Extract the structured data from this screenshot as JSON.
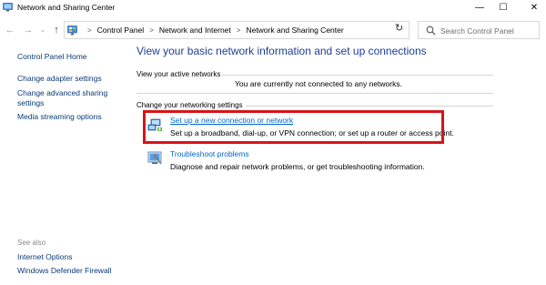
{
  "window": {
    "title": "Network and Sharing Center",
    "controls": {
      "minimize": "—",
      "maximize": "☐",
      "close": "✕"
    }
  },
  "nav": {
    "back": "←",
    "forward": "→",
    "recent": "⌄",
    "up": "↑",
    "breadcrumbs": [
      "Control Panel",
      "Network and Internet",
      "Network and Sharing Center"
    ],
    "separator": ">",
    "dropdown": "⌄",
    "refresh": "↻",
    "search_placeholder": "Search Control Panel"
  },
  "sidebar": {
    "items": [
      {
        "label": "Control Panel Home"
      },
      {
        "label": "Change adapter settings"
      },
      {
        "label": "Change advanced sharing settings"
      },
      {
        "label": "Media streaming options"
      }
    ],
    "see_also": {
      "heading": "See also",
      "items": [
        {
          "label": "Internet Options"
        },
        {
          "label": "Windows Defender Firewall"
        }
      ]
    }
  },
  "main": {
    "title": "View your basic network information and set up connections",
    "active_networks": {
      "label": "View your active networks",
      "status": "You are currently not connected to any networks."
    },
    "change_settings": {
      "label": "Change your networking settings",
      "tasks": [
        {
          "link": "Set up a new connection or network",
          "description": "Set up a broadband, dial-up, or VPN connection; or set up a router or access point."
        },
        {
          "link": "Troubleshoot problems",
          "description": "Diagnose and repair network problems, or get troubleshooting information."
        }
      ]
    }
  },
  "colors": {
    "title_blue": "#1c3f94",
    "link_blue": "#0066cc",
    "sidebar_link": "#0b3a78",
    "highlight_red": "#d7141a"
  }
}
